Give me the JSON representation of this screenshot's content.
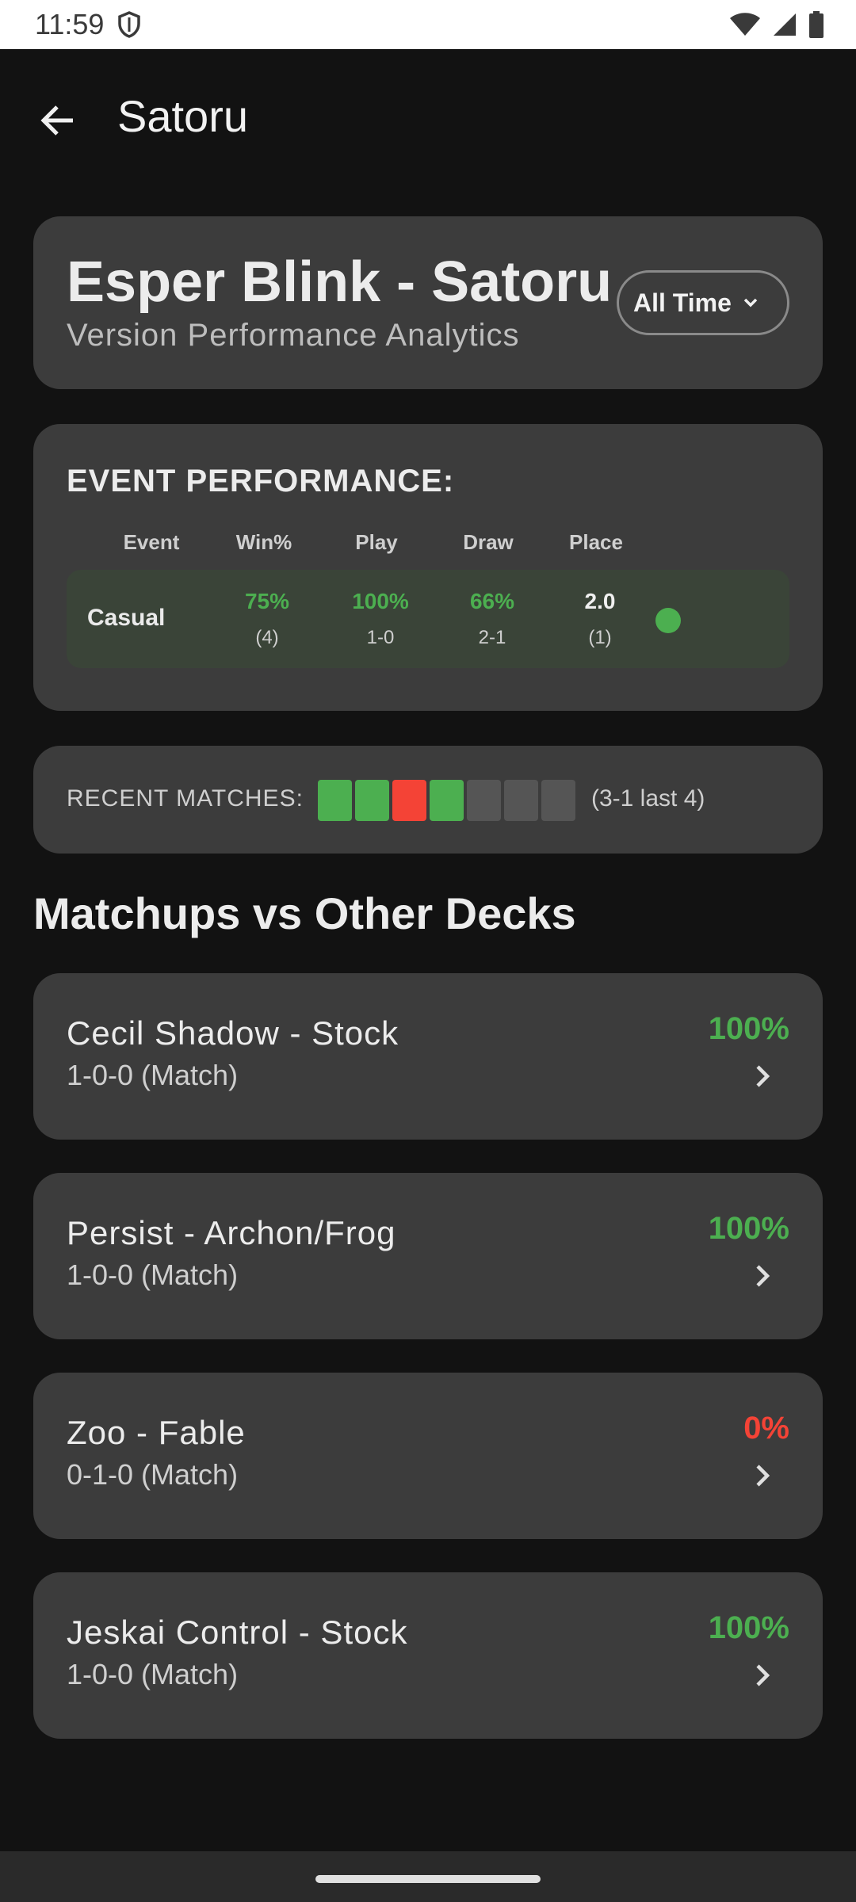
{
  "status_bar": {
    "time": "11:59",
    "icons": [
      "shield-icon",
      "wifi-icon",
      "signal-icon",
      "battery-icon"
    ]
  },
  "app_bar": {
    "title": "Satoru",
    "back_icon": "arrow-back-icon"
  },
  "header": {
    "deck_name": "Esper Blink - Satoru",
    "subtitle": "Version Performance Analytics",
    "time_filter": "All Time"
  },
  "event_performance": {
    "title": "EVENT PERFORMANCE:",
    "columns": [
      "Event",
      "Win%",
      "Play",
      "Draw",
      "Place"
    ],
    "rows": [
      {
        "event": "Casual",
        "win_pct": "75%",
        "win_count": "(4)",
        "play_pct": "100%",
        "play_record": "1-0",
        "draw_pct": "66%",
        "draw_record": "2-1",
        "place": "2.0",
        "place_count": "(1)",
        "status_color": "#4caf50"
      }
    ]
  },
  "recent_matches": {
    "label": "RECENT MATCHES:",
    "results": [
      "win",
      "win",
      "loss",
      "win",
      "none",
      "none",
      "none"
    ],
    "summary": "(3-1 last 4)"
  },
  "matchups": {
    "title": "Matchups vs Other Decks",
    "items": [
      {
        "name": "Cecil Shadow - Stock",
        "record": "1-0-0 (Match)",
        "pct": "100%",
        "color": "#4caf50"
      },
      {
        "name": "Persist - Archon/Frog",
        "record": "1-0-0 (Match)",
        "pct": "100%",
        "color": "#4caf50"
      },
      {
        "name": "Zoo - Fable",
        "record": "0-1-0 (Match)",
        "pct": "0%",
        "color": "#f44336"
      },
      {
        "name": "Jeskai Control - Stock",
        "record": "1-0-0 (Match)",
        "pct": "100%",
        "color": "#4caf50"
      }
    ]
  },
  "colors": {
    "background": "#121212",
    "card": "#3c3c3c",
    "win": "#4caf50",
    "loss": "#f44336"
  }
}
